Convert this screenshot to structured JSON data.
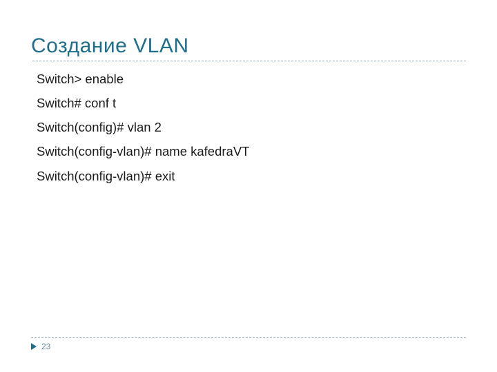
{
  "title": "Создание VLAN",
  "lines": [
    "Switch> enable",
    "Switch# conf t",
    "Switch(config)# vlan 2",
    "Switch(config-vlan)# name kafedraVT",
    "Switch(config-vlan)# exit"
  ],
  "page_number": "23",
  "colors": {
    "accent": "#1f6e8c",
    "dashed": "#8fa8b5"
  }
}
